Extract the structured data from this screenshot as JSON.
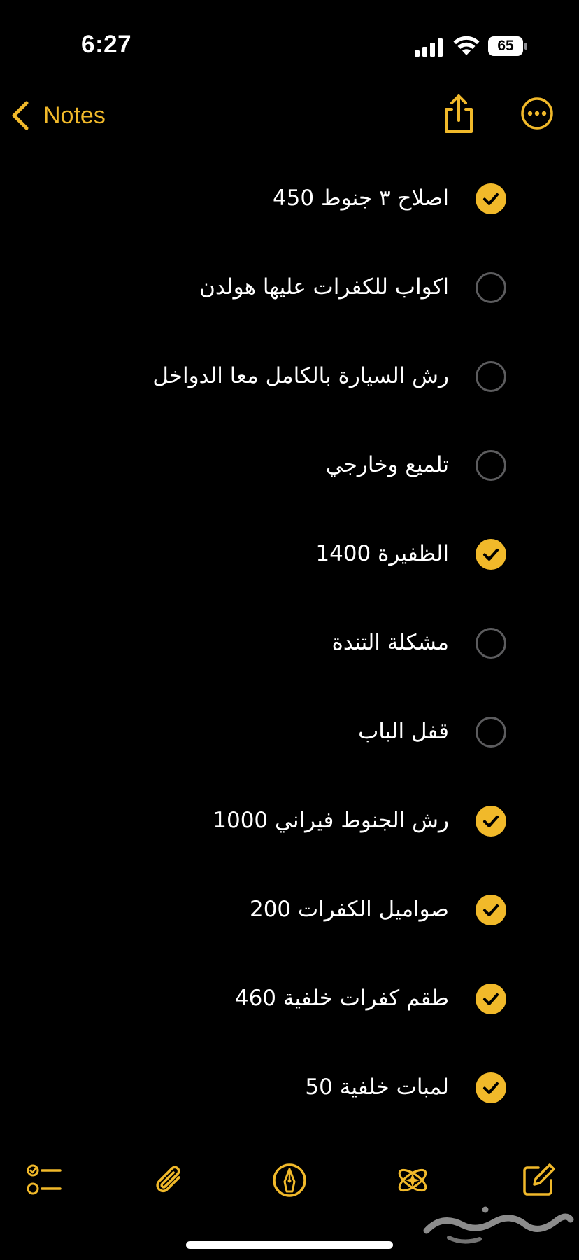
{
  "status": {
    "time": "6:27",
    "battery": "65"
  },
  "nav": {
    "back_label": "Notes"
  },
  "checklist": [
    {
      "text": "اصلاح ٣ جنوط 450",
      "checked": true
    },
    {
      "text": "اكواب للكفرات عليها هولدن",
      "checked": false
    },
    {
      "text": "رش السيارة بالكامل معا الدواخل",
      "checked": false
    },
    {
      "text": "تلميع وخارجي",
      "checked": false
    },
    {
      "text": "الظفيرة 1400",
      "checked": true
    },
    {
      "text": "مشكلة التندة",
      "checked": false
    },
    {
      "text": "قفل الباب",
      "checked": false
    },
    {
      "text": "رش الجنوط فيراني 1000",
      "checked": true
    },
    {
      "text": "صواميل الكفرات 200",
      "checked": true
    },
    {
      "text": "طقم كفرات خلفية 460",
      "checked": true
    },
    {
      "text": "لمبات خلفية 50",
      "checked": true
    }
  ],
  "colors": {
    "accent": "#f1b92a",
    "background": "#000000",
    "unchecked_ring": "#5c5c5e"
  },
  "toolbar": {
    "icons": [
      "checklist-icon",
      "paperclip-icon",
      "markup-pen-icon",
      "apple-intelligence-icon",
      "compose-icon"
    ]
  },
  "watermark": {
    "text": "حراج"
  }
}
